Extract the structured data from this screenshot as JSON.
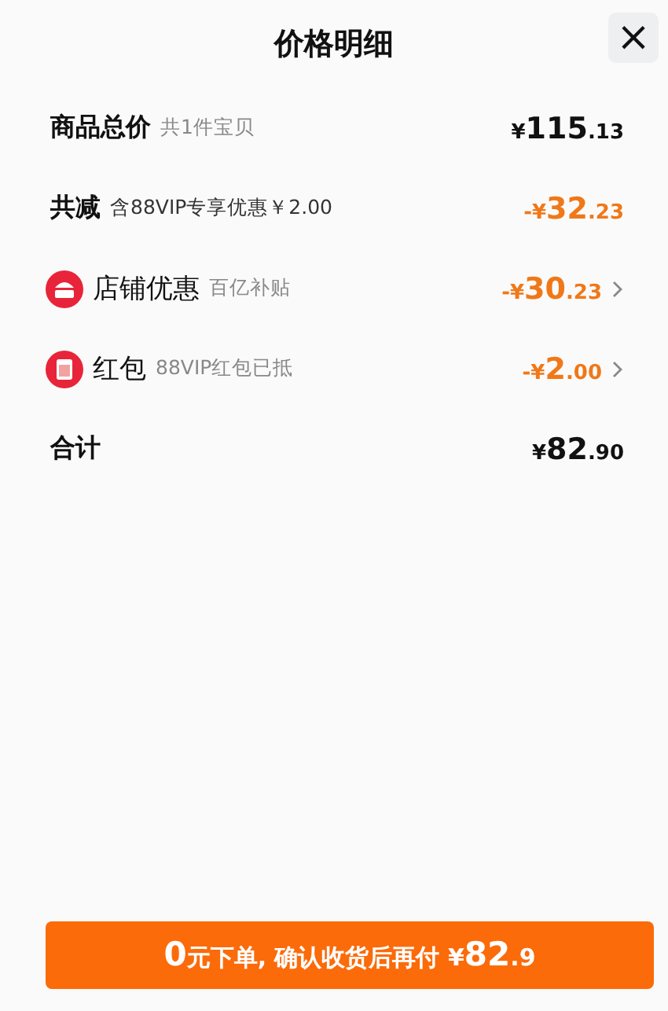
{
  "header": {
    "title": "价格明细",
    "close": "×"
  },
  "rows": [
    {
      "kind": "plain",
      "label": "商品总价",
      "note": "共1件宝贝",
      "discount": false,
      "chevron": false,
      "price": {
        "currency": "¥",
        "whole": "115",
        "fraction": ".13"
      }
    },
    {
      "kind": "plain",
      "label": "共减",
      "note": "含88VIP专享优惠￥2.00",
      "discount": true,
      "chevron": false,
      "price": {
        "currency": "-¥",
        "whole": "32",
        "fraction": ".23"
      }
    },
    {
      "kind": "shop",
      "label": "店铺优惠",
      "note": "百亿补贴",
      "discount": true,
      "chevron": true,
      "price": {
        "currency": "-¥",
        "whole": "30",
        "fraction": ".23"
      }
    },
    {
      "kind": "red-packet",
      "label": "红包",
      "note": "88VIP红包已抵",
      "discount": true,
      "chevron": true,
      "price": {
        "currency": "-¥",
        "whole": "2",
        "fraction": ".00"
      }
    },
    {
      "kind": "plain",
      "label": "合计",
      "discount": false,
      "chevron": false,
      "price": {
        "currency": "¥",
        "whole": "82",
        "fraction": ".90"
      }
    }
  ],
  "pay_button": [
    {
      "kind": "big",
      "text": "0"
    },
    {
      "kind": "small",
      "text": "元下单, 确认收货后再付 ¥"
    },
    {
      "kind": "big",
      "text": "82"
    },
    {
      "kind": "small",
      "text": ".9"
    }
  ]
}
